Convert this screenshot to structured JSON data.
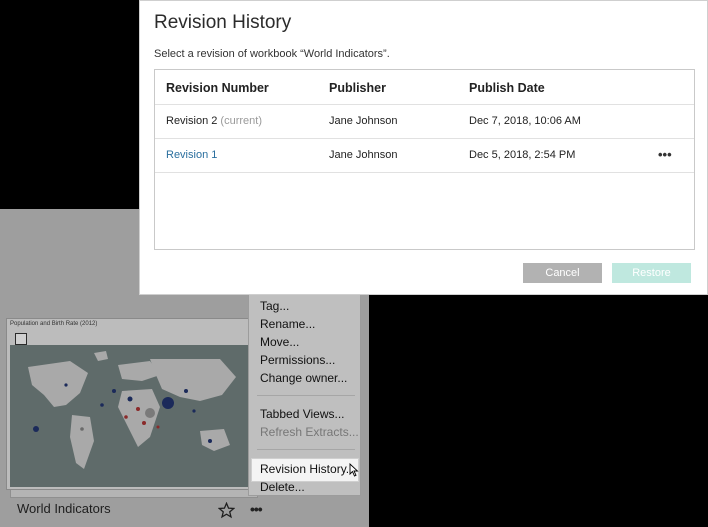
{
  "dialog": {
    "title": "Revision History",
    "subtitle": "Select a revision of workbook “World Indicators”.",
    "columns": [
      "Revision Number",
      "Publisher",
      "Publish Date"
    ],
    "rows": [
      {
        "revision": "Revision 2",
        "current_tag": "(current)",
        "publisher": "Jane Johnson",
        "date": "Dec 7, 2018, 10:06 AM"
      },
      {
        "revision": "Revision 1",
        "current_tag": "",
        "publisher": "Jane Johnson",
        "date": "Dec 5, 2018, 2:54 PM",
        "more": "•••"
      }
    ],
    "cancel_label": "Cancel",
    "restore_label": "Restore"
  },
  "workbook": {
    "thumbnail_title": "Population and Birth Rate (2012)",
    "name": "World Indicators",
    "more": "•••"
  },
  "context_menu": {
    "items": [
      "Tag...",
      "Rename...",
      "Move...",
      "Permissions...",
      "Change owner...",
      "Tabbed Views...",
      "Refresh Extracts...",
      "Revision History...",
      "Delete..."
    ]
  },
  "colors": {
    "link": "#2a6f9e",
    "restore_disabled": "#bfe8df",
    "cancel": "#b2b2b2"
  },
  "icons": {
    "star": "star-icon",
    "cursor": "pointer-cursor-icon",
    "more": "more-options-icon"
  }
}
